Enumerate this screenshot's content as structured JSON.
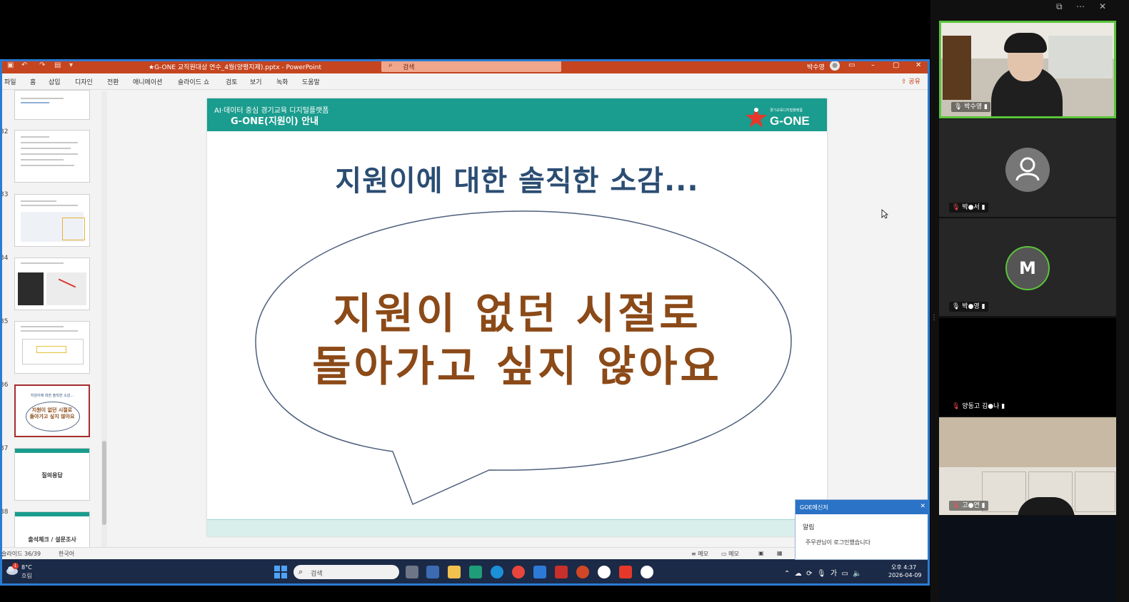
{
  "powerpoint": {
    "doc_title": "★G-ONE 교직원대상 연수_4월(양평지제).pptx  -  PowerPoint",
    "search_placeholder": "검색",
    "user_name": "박수영",
    "menu": [
      "파일",
      "홈",
      "삽입",
      "디자인",
      "전환",
      "애니메이션",
      "슬라이드 쇼",
      "검토",
      "보기",
      "녹화",
      "도움말"
    ],
    "share_label": "공유",
    "thumbnail_numbers": [
      "32",
      "33",
      "34",
      "35",
      "36",
      "37",
      "38"
    ],
    "thumb36_title": "지원이에 대한 솔직한 소감...",
    "thumb36_text": "지원이 없던 시절로\n돌아가고 싶지 않아요",
    "thumb37_label": "질의응답",
    "thumb38_label": "출석체크 / 설문조사",
    "slide": {
      "header_sub": "AI·데이터 중심 경기교육 디지털플랫폼",
      "header_main": "G-ONE(지원이) 안내",
      "logo_text": "G-ONE",
      "title": "지원이에 대한 솔직한 소감...",
      "bubble_line1": "지원이 없던 시절로",
      "bubble_line2": "돌아가고 싶지 않아요"
    },
    "status": {
      "slide_pos": "슬라이드 36/39",
      "language": "한국어",
      "notes": "메모",
      "comments": "메모"
    }
  },
  "taskbar": {
    "weather_temp": "8°C",
    "weather_desc": "흐림",
    "weather_badge": "1",
    "search_placeholder": "검색",
    "ime": "가",
    "clock_time": "오후 4:37",
    "clock_date": "2026-04-09"
  },
  "messenger": {
    "title": "GOE메신저",
    "subtitle": "알림",
    "body": "주무관님이 로그인했습니다"
  },
  "participants": [
    {
      "name": "박수영",
      "type": "video",
      "active": true
    },
    {
      "name": "박●서",
      "type": "avatar-icon",
      "muted": true
    },
    {
      "name": "박●영",
      "type": "avatar-letter",
      "letter": "M",
      "muted": false
    },
    {
      "name": "양동고 김●나",
      "type": "black",
      "muted": true
    },
    {
      "name": "고●연",
      "type": "video",
      "muted": true
    }
  ],
  "colors": {
    "ppt_accent": "#c4451f",
    "slide_teal": "#1a9c8e",
    "slide_title": "#2b4d73",
    "bubble_text": "#8b4a18",
    "active_speaker": "#5ac43a"
  }
}
